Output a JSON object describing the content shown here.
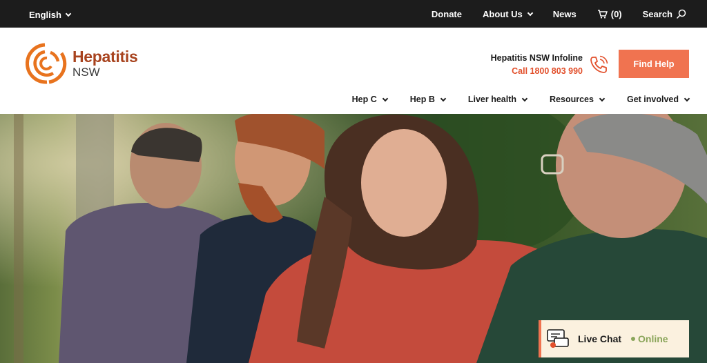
{
  "topbar": {
    "language": "English",
    "donate": "Donate",
    "about": "About Us",
    "news": "News",
    "cart_count": "(0)",
    "search": "Search"
  },
  "brand": {
    "name_line1": "Hepatitis",
    "name_line2": "NSW",
    "accent_color": "#f07350",
    "logo_color": "#e8731e"
  },
  "infoline": {
    "title": "Hepatitis NSW Infoline",
    "call": "Call 1800 803 990"
  },
  "cta": {
    "find_help": "Find Help"
  },
  "nav": {
    "items": [
      {
        "label": "Hep C"
      },
      {
        "label": "Hep B"
      },
      {
        "label": "Liver health"
      },
      {
        "label": "Resources"
      },
      {
        "label": "Get involved"
      }
    ]
  },
  "livechat": {
    "label": "Live Chat",
    "status": "Online",
    "status_color": "#8aa55a"
  }
}
